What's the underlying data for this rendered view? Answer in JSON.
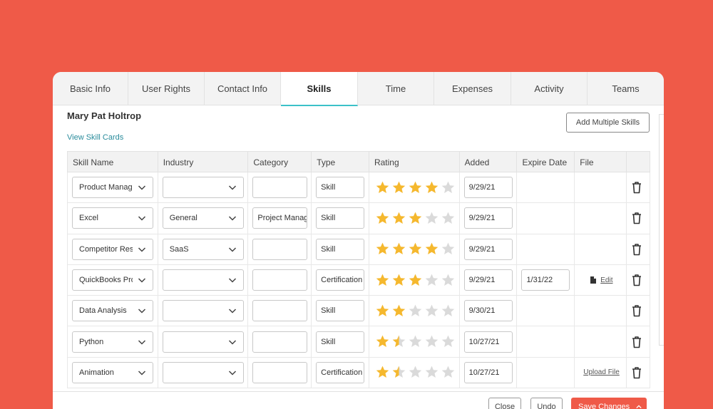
{
  "tabs": [
    "Basic Info",
    "User Rights",
    "Contact Info",
    "Skills",
    "Time",
    "Expenses",
    "Activity",
    "Teams"
  ],
  "active_tab": "Skills",
  "user_name": "Mary Pat Holtrop",
  "view_skill_cards": "View Skill Cards",
  "add_multiple_skills": "Add Multiple Skills",
  "columns": [
    "Skill Name",
    "Industry",
    "Category",
    "Type",
    "Rating",
    "Added",
    "Expire Date",
    "File"
  ],
  "rows": [
    {
      "skill": "Product Manager",
      "industry": "",
      "category": "",
      "type": "Skill",
      "rating": 4,
      "added": "9/29/21",
      "expire": "",
      "file": ""
    },
    {
      "skill": "Excel",
      "industry": "General",
      "category": "Project Management",
      "type": "Skill",
      "rating": 3,
      "added": "9/29/21",
      "expire": "",
      "file": ""
    },
    {
      "skill": "Competitor Research",
      "industry": "SaaS",
      "category": "",
      "type": "Skill",
      "rating": 4,
      "added": "9/29/21",
      "expire": "",
      "file": ""
    },
    {
      "skill": "QuickBooks Pro Advisor",
      "industry": "",
      "category": "",
      "type": "Certification",
      "rating": 3,
      "added": "9/29/21",
      "expire": "1/31/22",
      "file": "Edit"
    },
    {
      "skill": "Data Analysis",
      "industry": "",
      "category": "",
      "type": "Skill",
      "rating": 2,
      "added": "9/30/21",
      "expire": "",
      "file": ""
    },
    {
      "skill": "Python",
      "industry": "",
      "category": "",
      "type": "Skill",
      "rating": 1.5,
      "added": "10/27/21",
      "expire": "",
      "file": ""
    },
    {
      "skill": "Animation",
      "industry": "",
      "category": "",
      "type": "Certification",
      "rating": 1.5,
      "added": "10/27/21",
      "expire": "",
      "file": "Upload File"
    }
  ],
  "footer": {
    "close": "Close",
    "undo": "Undo",
    "save": "Save Changes"
  },
  "colors": {
    "background": "#EF5A48",
    "accent_tab": "#3CC1C9",
    "star_filled": "#F5B82E",
    "star_empty": "#DADADA",
    "link": "#2A8C9C"
  }
}
